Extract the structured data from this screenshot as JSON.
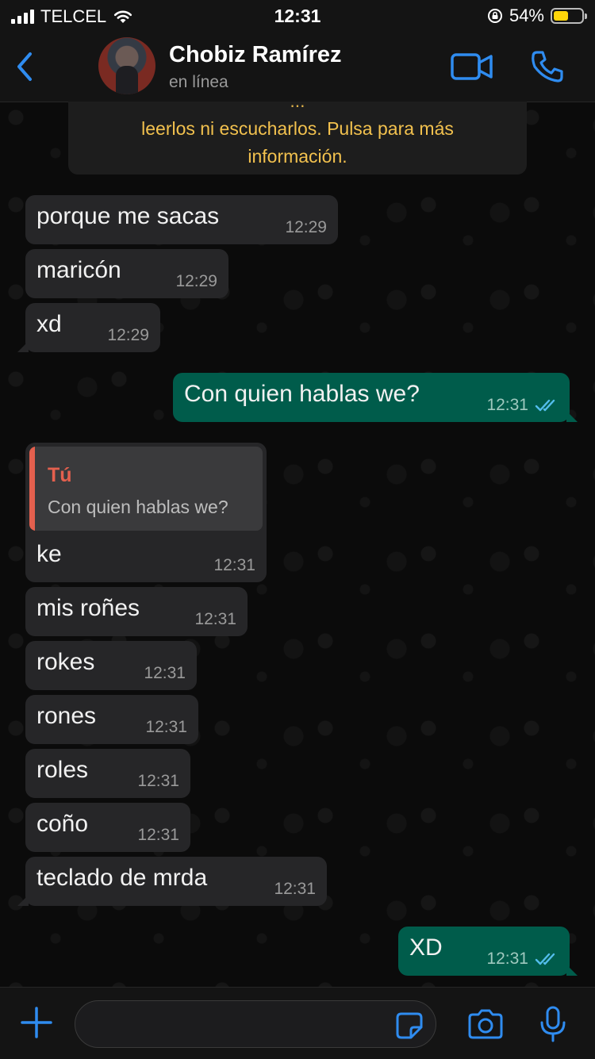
{
  "status_bar": {
    "carrier": "TELCEL",
    "time": "12:31",
    "battery_percent": "54%",
    "battery_level": 0.54
  },
  "header": {
    "contact_name": "Chobiz Ramírez",
    "contact_status": "en línea",
    "icons": [
      "back-chevron-icon",
      "video-call-icon",
      "phone-call-icon"
    ]
  },
  "encryption_notice": {
    "line_cut": "...",
    "line1": "leerlos ni escucharlos. Pulsa para más",
    "line2": "información."
  },
  "messages": [
    {
      "direction": "in",
      "text": "porque me sacas",
      "time": "12:29"
    },
    {
      "direction": "in",
      "text": "maricón",
      "time": "12:29"
    },
    {
      "direction": "in",
      "text": "xd",
      "time": "12:29"
    },
    {
      "direction": "out",
      "text": "Con quien hablas we?",
      "time": "12:31",
      "read": true
    },
    {
      "direction": "in",
      "text": "ke",
      "time": "12:31",
      "quote": {
        "author": "Tú",
        "text": "Con quien hablas we?"
      }
    },
    {
      "direction": "in",
      "text": "mis roñes",
      "time": "12:31"
    },
    {
      "direction": "in",
      "text": "rokes",
      "time": "12:31"
    },
    {
      "direction": "in",
      "text": "rones",
      "time": "12:31"
    },
    {
      "direction": "in",
      "text": "roles",
      "time": "12:31"
    },
    {
      "direction": "in",
      "text": "coño",
      "time": "12:31"
    },
    {
      "direction": "in",
      "text": "teclado de mrda",
      "time": "12:31"
    },
    {
      "direction": "out",
      "text": "XD",
      "time": "12:31",
      "read": true
    }
  ],
  "composer": {
    "value": "",
    "icons": [
      "plus-icon",
      "sticker-icon",
      "camera-icon",
      "microphone-icon"
    ]
  },
  "colors": {
    "accent_blue": "#2f8cf0",
    "incoming_bubble": "#262628",
    "outgoing_bubble": "#005c4b",
    "notice_text": "#f2c14e",
    "quote_accent": "#e4604e"
  }
}
